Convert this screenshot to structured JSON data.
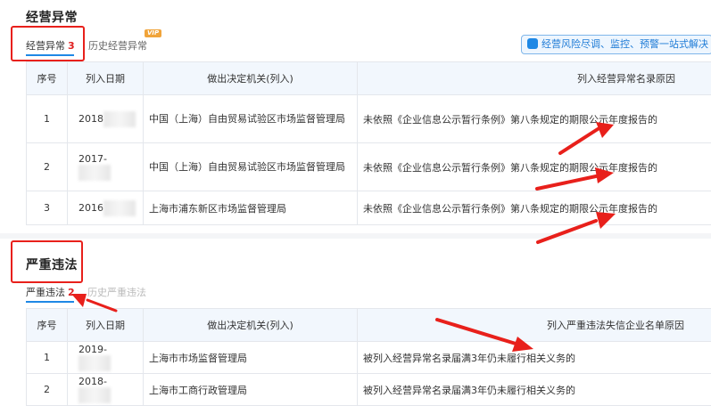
{
  "section1": {
    "title": "经营异常",
    "tab_active_label": "经营异常",
    "tab_active_count": "3",
    "tab_history_label": "历史经营异常",
    "vip_badge": "VIP",
    "promo_text": "经营风险尽调、监控、预警一站式解决",
    "table": {
      "headers": [
        "序号",
        "列入日期",
        "做出决定机关(列入)",
        "列入经营异常名录原因"
      ],
      "rows": [
        {
          "no": "1",
          "date": "2018",
          "authority": "中国（上海）自由贸易试验区市场监督管理局",
          "reason": "未依照《企业信息公示暂行条例》第八条规定的期限公示年度报告的"
        },
        {
          "no": "2",
          "date": "2017-",
          "authority": "中国（上海）自由贸易试验区市场监督管理局",
          "reason": "未依照《企业信息公示暂行条例》第八条规定的期限公示年度报告的"
        },
        {
          "no": "3",
          "date": "2016",
          "authority": "上海市浦东新区市场监督管理局",
          "reason": "未依照《企业信息公示暂行条例》第八条规定的期限公示年度报告的"
        }
      ]
    }
  },
  "section2": {
    "title": "严重违法",
    "tab_active_label": "严重违法",
    "tab_active_count": "2",
    "tab_history_label": "历史严重违法",
    "table": {
      "headers": [
        "序号",
        "列入日期",
        "做出决定机关(列入)",
        "列入严重违法失信企业名单原因"
      ],
      "rows": [
        {
          "no": "1",
          "date": "2019-",
          "authority": "上海市市场监督管理局",
          "reason": "被列入经营异常名录届满3年仍未履行相关义务的"
        },
        {
          "no": "2",
          "date": "2018-",
          "authority": "上海市工商行政管理局",
          "reason": "被列入经营异常名录届满3年仍未履行相关义务的"
        }
      ]
    }
  },
  "colors": {
    "accent": "#1e88e5",
    "annotation_red": "#e8201b",
    "count_red": "#e02020"
  },
  "icons": {
    "promo": "document-icon"
  }
}
